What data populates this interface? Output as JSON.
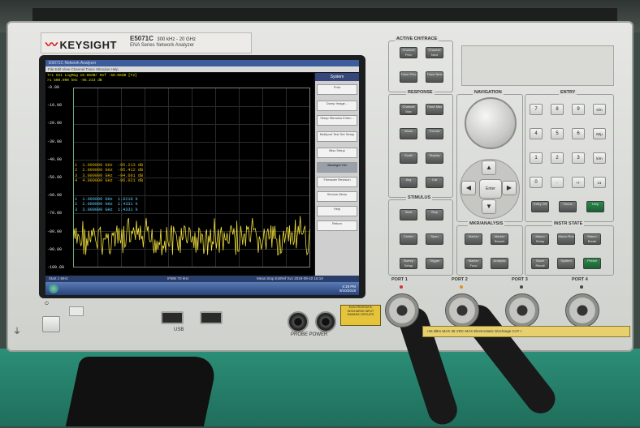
{
  "instrument": {
    "brand": "KEYSIGHT",
    "model": "E5071C",
    "freq_range": "300 kHz - 20 GHz",
    "series": "ENA Series  Network Analyzer"
  },
  "screen": {
    "window_title": "E5071C Network Analyzer",
    "menu": "File  Edit  View  Channel  Trace  Stimulus  Help",
    "trace_header_1": "Tr1 S21 LogMag 10.00dB/ Ref -50.00dB [F2]",
    "trace_header_2": ">1  500.000 kHz  -95.213 dB",
    "y_ticks": [
      "-0.00",
      "-10.00",
      "-20.00",
      "-30.00",
      "-40.00",
      "-50.00",
      "-60.00",
      "-70.00",
      "-80.00",
      "-90.00",
      "-100.00"
    ],
    "marker_block_a": "1  1.000000 GHz  -95.213 dB\n2  2.000000 GHz  -95.412 dB\n3  3.000000 GHz  -94.601 dB\n4  4.000000 GHz  -96.021 dB",
    "marker_block_b": "1  1.000000 GHz  1.0210 k\n2  2.000000 GHz  1.4331 k\n3  3.000000 GHz  1.4331 k",
    "softkeys": {
      "header": "System",
      "items": [
        "Print",
        "Dump Image...",
        "Setup Stimulus Exten...",
        "Multiport Test Set Setup",
        "Misc Setup",
        "Backlight ON",
        "Firmware Revision",
        "Service Menu",
        "Help",
        "Return"
      ]
    },
    "status_left": "Start 1 MHz",
    "status_mid": "IFBW 70 kHz",
    "status_right": "Meas  Stop  ExtRef  Svc  2019-09-10 16:19",
    "clock_time": "4:19 PM",
    "clock_date": "9/10/2019"
  },
  "panel": {
    "active_ch_trace": {
      "title": "ACTIVE CH/TRACE",
      "buttons": [
        "Channel Prev",
        "Channel Next",
        "Trace Prev",
        "Trace Next"
      ]
    },
    "response": {
      "title": "RESPONSE",
      "buttons": [
        "Channel Max",
        "Trace Max",
        "Meas",
        "Format",
        "Scale",
        "Display",
        "Avg",
        "Cal"
      ]
    },
    "navigation": {
      "title": "NAVIGATION",
      "enter": "Enter"
    },
    "entry": {
      "title": "ENTRY",
      "keys": [
        "7",
        "8",
        "9",
        "G/n",
        "4",
        "5",
        "6",
        "M/μ",
        "1",
        "2",
        "3",
        "k/m",
        "0",
        ".",
        "+/-",
        "x1"
      ],
      "bottom": [
        "Entry Off",
        "Focus",
        "Help"
      ]
    },
    "stimulus": {
      "title": "STIMULUS",
      "buttons": [
        "Start",
        "Stop",
        "Center",
        "Span",
        "Sweep Setup",
        "Trigger"
      ]
    },
    "mkr_analysis": {
      "title": "MKR/ANALYSIS",
      "buttons": [
        "Marker",
        "Marker Search",
        "Marker Func",
        "Analysis"
      ]
    },
    "instr_state": {
      "title": "INSTR STATE",
      "buttons": [
        "Macro Setup",
        "Macro Run",
        "Macro Break",
        "Save/ Recall",
        "System",
        "Preset"
      ]
    }
  },
  "ports": [
    "PORT 1",
    "PORT 2",
    "PORT 3",
    "PORT 4"
  ],
  "esd_label": "ELECTROSTATIC DISCHARGE INPUT DAMAGE CIRCUITS",
  "warning_strip": "+26 dBm MAX  35 VDC MAX    Electrostatic Discharge CAT I",
  "usb_label": "USB",
  "probe_label": "PROBE POWER"
}
